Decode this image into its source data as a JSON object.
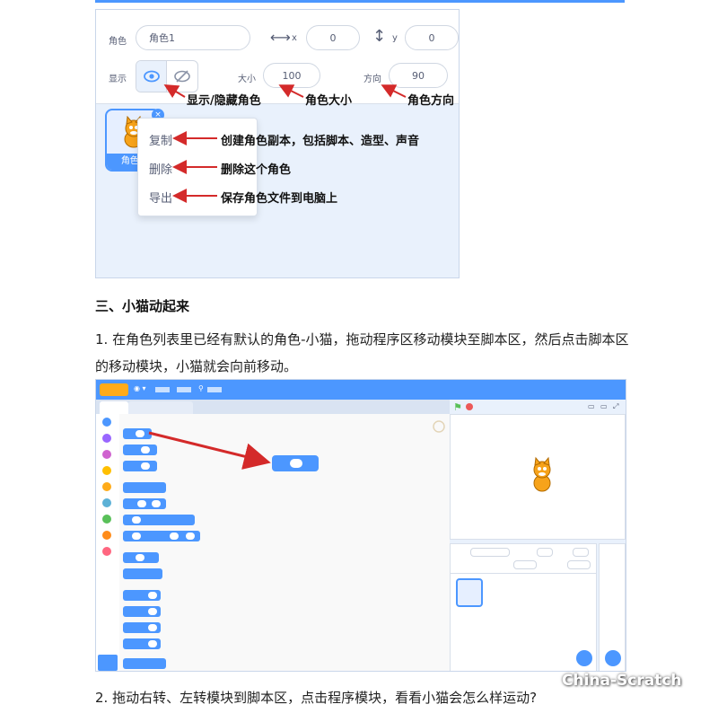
{
  "sprite_panel": {
    "sprite_label": "角色",
    "sprite_name": "角色1",
    "x_label": "x",
    "x_value": "0",
    "y_label": "y",
    "y_value": "0",
    "show_label": "显示",
    "size_label": "大小",
    "size_value": "100",
    "direction_label": "方向",
    "direction_value": "90",
    "tile_name": "角色1",
    "context_menu": {
      "copy": "复制",
      "delete": "删除",
      "export": "导出"
    }
  },
  "annotations": {
    "show_hide": "显示/隐藏角色",
    "size": "角色大小",
    "direction": "角色方向",
    "copy": "创建角色副本，包括脚本、造型、声音",
    "delete": "删除这个角色",
    "export": "保存角色文件到电脑上"
  },
  "section_heading": "三、小猫动起来",
  "paragraph_1": "1. 在角色列表里已经有默认的角色-小猫，拖动程序区移动模块至脚本区，然后点击脚本区的移动模块，小猫就会向前移动。",
  "paragraph_2": "2. 拖动右转、左转模块到脚本区，点击程序模块，看看小猫会怎么样运动?",
  "watermark": "China-Scratch",
  "colors": {
    "accent": "#4c97ff",
    "annotation_arrow": "#d42a2a"
  }
}
